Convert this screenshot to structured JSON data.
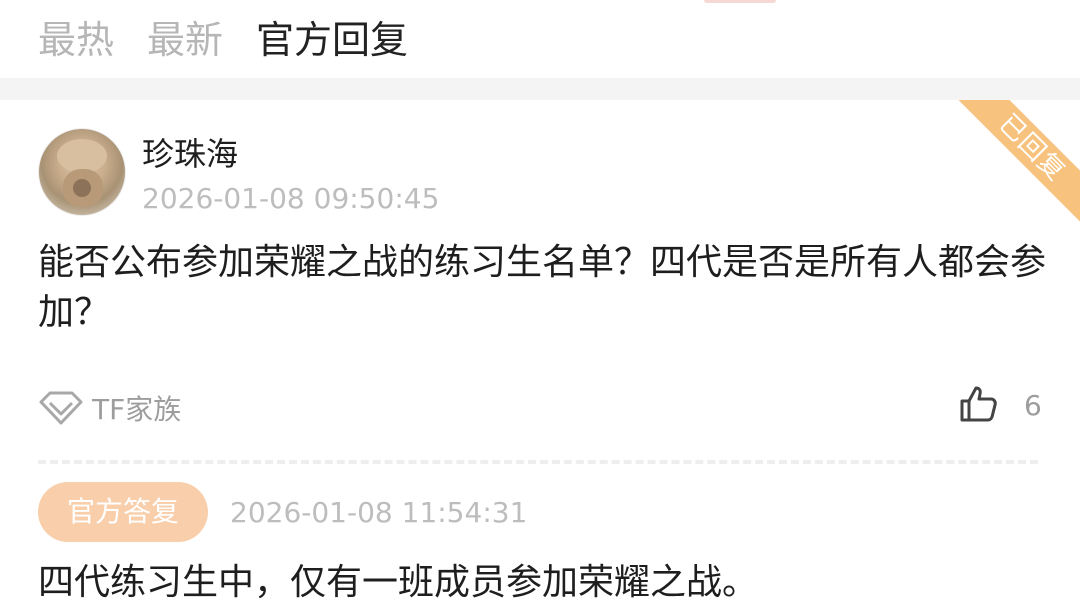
{
  "tabs": [
    {
      "label": "最热",
      "active": false
    },
    {
      "label": "最新",
      "active": false
    },
    {
      "label": "官方回复",
      "active": true
    }
  ],
  "post": {
    "username": "珍珠海",
    "timestamp": "2026-01-08 09:50:45",
    "content": "能否公布参加荣耀之战的练习生名单？四代是否是所有人都会参加？",
    "status_ribbon": "已回复",
    "tag": {
      "icon": "diamond-icon",
      "label": "TF家族"
    },
    "likes": {
      "icon": "thumbs-up-icon",
      "count": "6"
    }
  },
  "reply": {
    "badge": "官方答复",
    "timestamp": "2026-01-08 11:54:31",
    "content": "四代练习生中，仅有一班成员参加荣耀之战。"
  },
  "colors": {
    "ribbon": "#f7c27e",
    "badge": "#f8ceab",
    "active_tab": "#222222",
    "inactive_tab": "#b6b6b6",
    "meta_text": "#bdbdbd"
  }
}
